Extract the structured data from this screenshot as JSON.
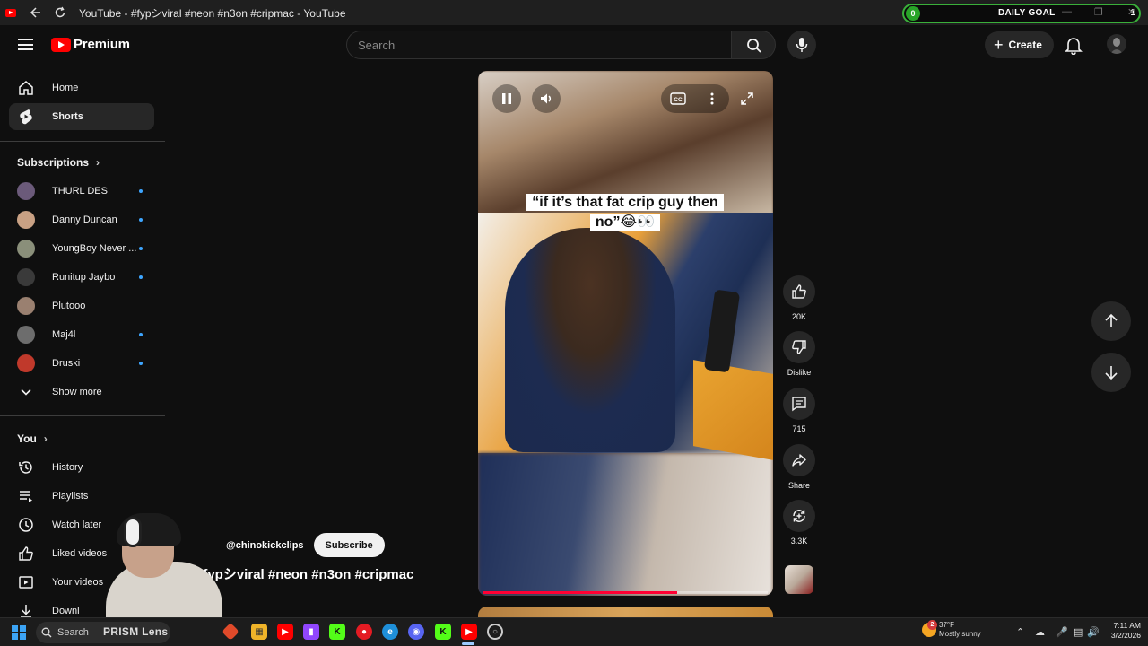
{
  "window": {
    "title": "YouTube - #fypシviral #neon #n3on #cripmac - YouTube",
    "daily_goal": {
      "count": "0",
      "label": "DAILY GOAL",
      "right": "1"
    }
  },
  "header": {
    "logo_text": "Premium",
    "search_placeholder": "Search",
    "create_label": "Create"
  },
  "sidebar": {
    "nav": [
      {
        "label": "Home",
        "icon": "home-icon",
        "active": false
      },
      {
        "label": "Shorts",
        "icon": "shorts-icon",
        "active": true
      }
    ],
    "subscriptions_header": "Subscriptions",
    "subscriptions": [
      {
        "name": "THURL DES",
        "new": true,
        "color": "#6b5a7a"
      },
      {
        "name": "Danny Duncan",
        "new": true,
        "color": "#c9a184"
      },
      {
        "name": "YoungBoy Never ...",
        "new": true,
        "color": "#8a8f7a"
      },
      {
        "name": "Runitup Jaybo",
        "new": true,
        "color": "#3a3a3a"
      },
      {
        "name": "Plutooo",
        "new": false,
        "color": "#9a8070"
      },
      {
        "name": "Maj4l",
        "new": true,
        "color": "#6d6d6d"
      },
      {
        "name": "Druski",
        "new": true,
        "color": "#c0392b"
      }
    ],
    "show_more": "Show more",
    "you_header": "You",
    "you_items": [
      {
        "label": "History",
        "icon": "history-icon"
      },
      {
        "label": "Playlists",
        "icon": "playlists-icon"
      },
      {
        "label": "Watch later",
        "icon": "watch-later-icon"
      },
      {
        "label": "Liked videos",
        "icon": "liked-videos-icon"
      },
      {
        "label": "Your videos",
        "icon": "your-videos-icon"
      },
      {
        "label": "Downl",
        "icon": "downloads-icon"
      }
    ]
  },
  "short": {
    "caption_line1": "“if it’s that fat crip guy then",
    "caption_line2": "no”😂👀",
    "channel_handle": "@chinokickclips",
    "subscribe_label": "Subscribe",
    "title": "#fypシviral #neon #n3on #cripmac",
    "progress": 0.68,
    "accent": "#ff0033"
  },
  "actions": {
    "like_count": "20K",
    "dislike_label": "Dislike",
    "comment_count": "715",
    "share_label": "Share",
    "remix_count": "3.3K"
  },
  "taskbar": {
    "search_label": "Search",
    "overlay_label": "PRISM Lens",
    "weather_badge": "2",
    "weather_temp": "37°F",
    "weather_desc": "Mostly sunny",
    "time": "7:11 AM",
    "date": "3/2/2026"
  }
}
